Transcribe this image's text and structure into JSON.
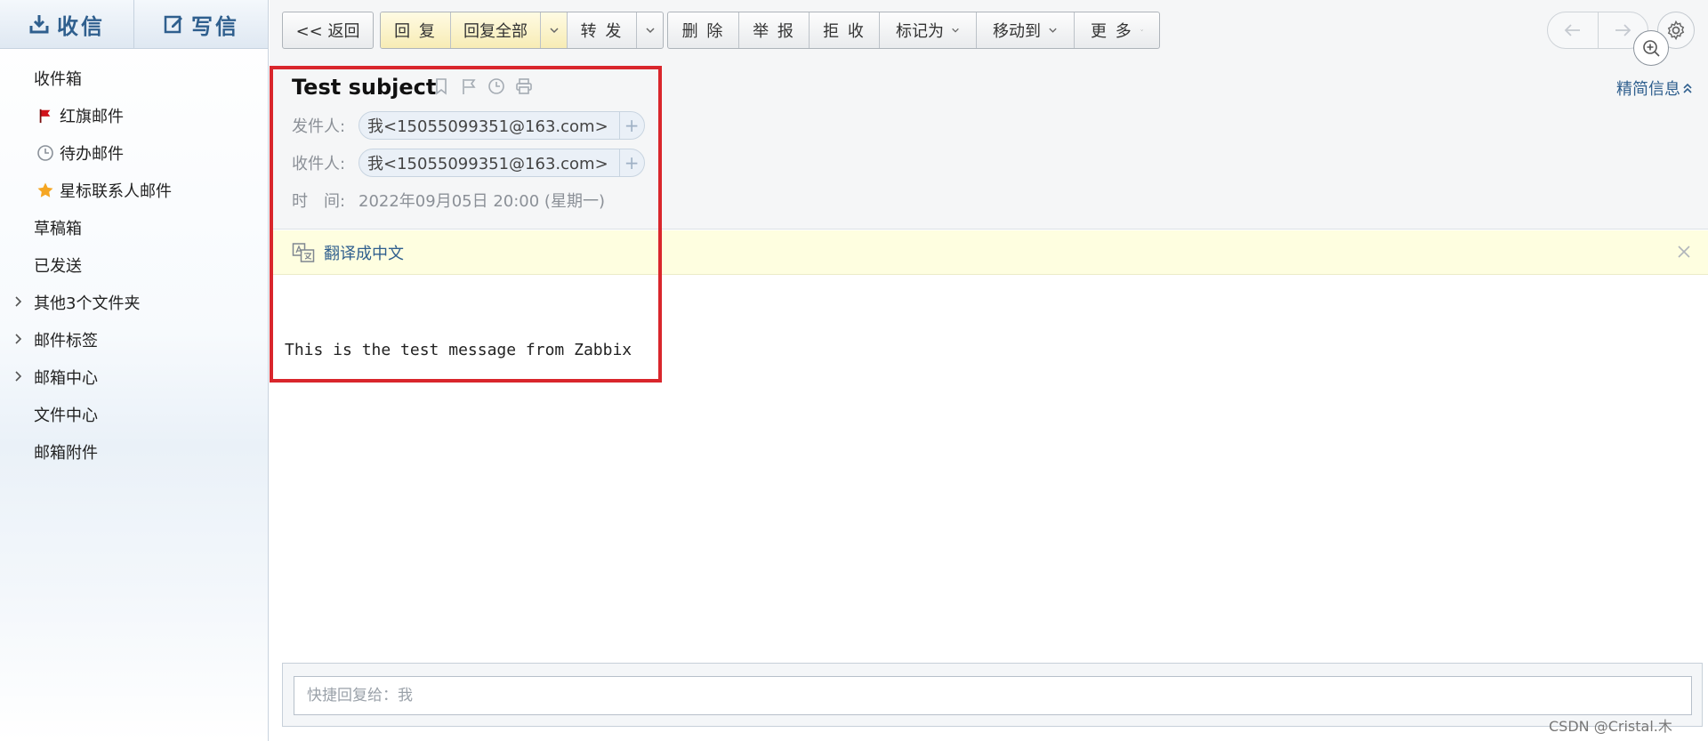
{
  "sidebar": {
    "receive_label": "收信",
    "compose_label": "写信",
    "items": [
      {
        "label": "收件箱",
        "icon": "none"
      },
      {
        "label": "红旗邮件",
        "icon": "red-flag-icon"
      },
      {
        "label": "待办邮件",
        "icon": "clock-icon"
      },
      {
        "label": "星标联系人邮件",
        "icon": "star-icon"
      },
      {
        "label": "草稿箱",
        "icon": "none"
      },
      {
        "label": "已发送",
        "icon": "none"
      },
      {
        "label": "其他3个文件夹",
        "icon": "chevron-right-icon"
      },
      {
        "label": "邮件标签",
        "icon": "chevron-right-icon"
      },
      {
        "label": "邮箱中心",
        "icon": "chevron-right-icon"
      },
      {
        "label": "文件中心",
        "icon": "none"
      },
      {
        "label": "邮箱附件",
        "icon": "none"
      }
    ]
  },
  "toolbar": {
    "back_label": "<< 返回",
    "reply_label": "回 复",
    "reply_all_label": "回复全部",
    "forward_label": "转 发",
    "delete_label": "删 除",
    "report_label": "举 报",
    "reject_label": "拒 收",
    "mark_as_label": "标记为",
    "move_to_label": "移动到",
    "more_label": "更 多"
  },
  "message": {
    "subject": "Test subject",
    "from_label": "发件人:",
    "from_value": "我<15055099351@163.com>",
    "to_label": "收件人:",
    "to_value": "我<15055099351@163.com>",
    "time_label": "时　间:",
    "time_value": "2022年09月05日 20:00 (星期一)",
    "simplify_label": "精简信息",
    "translate_label": "翻译成中文",
    "body": "This is the test message from Zabbix"
  },
  "quick_reply": {
    "placeholder": "快捷回复给：我"
  },
  "watermark": "CSDN @Cristal.木",
  "colors": {
    "accent": "#2f5f8e",
    "highlight_border": "#d9262c",
    "translate_bg": "#fefee0",
    "reply_yellow": "#f7ecb5"
  }
}
